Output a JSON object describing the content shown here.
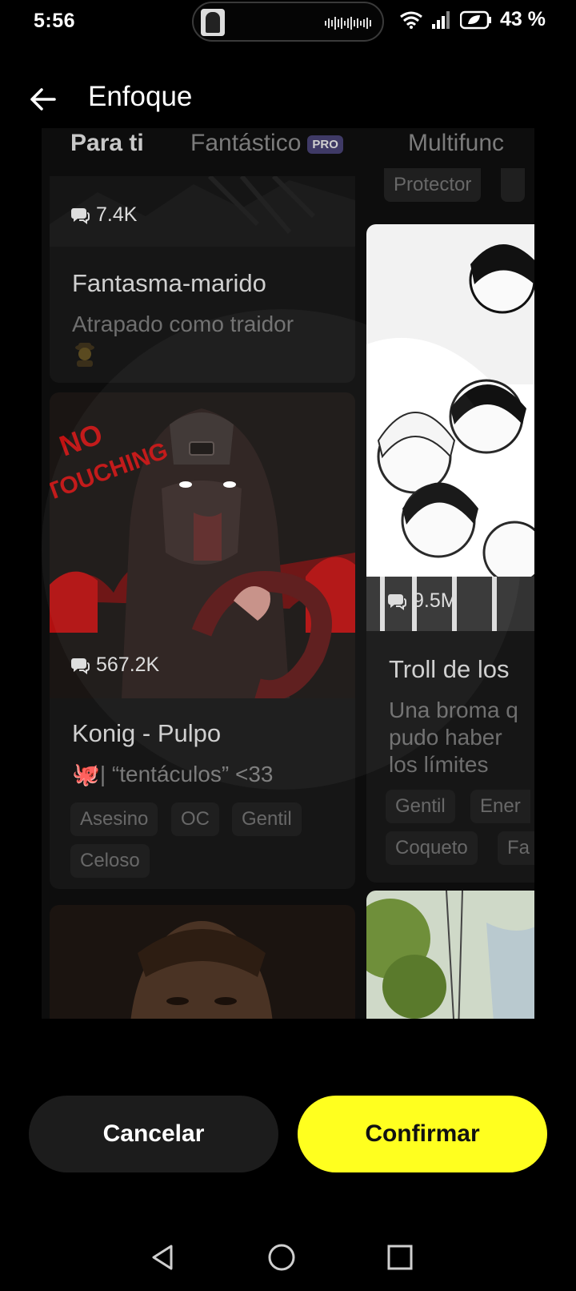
{
  "status_bar": {
    "time": "5:56",
    "battery_percent": "43 %",
    "icons": [
      "wifi-icon",
      "signal-icon",
      "battery-saver-icon"
    ]
  },
  "header": {
    "title": "Enfoque",
    "back_icon": "arrow-left-icon"
  },
  "preview": {
    "tabs": [
      {
        "label": "Para ti",
        "active": true
      },
      {
        "label": "Fantástico",
        "badge": "PRO"
      },
      {
        "label": "Multifunc"
      }
    ],
    "left_column": {
      "top_card": {
        "count": "7.4K",
        "title": "Fantasma-marido",
        "subtitle": "Atrapado como traidor"
      },
      "main_card": {
        "count": "567.2K",
        "title": "Konig - Pulpo",
        "subtitle": "🐙| “tentáculos” <33",
        "tags": [
          "Asesino",
          "OC",
          "Gentil",
          "Celoso"
        ]
      }
    },
    "right_column": {
      "top_tags": [
        "Protector"
      ],
      "main_card": {
        "count": "9.5M",
        "title": "Troll de los",
        "subtitle_lines": [
          "Una broma q",
          "pudo haber",
          "los límites"
        ],
        "tags": [
          "Gentil",
          "Ener",
          "Coqueto",
          "Fa"
        ]
      }
    }
  },
  "actions": {
    "cancel_label": "Cancelar",
    "confirm_label": "Confirmar"
  },
  "colors": {
    "confirm_bg": "#ffff1f",
    "cancel_bg": "#1c1c1c",
    "background": "#000000"
  }
}
